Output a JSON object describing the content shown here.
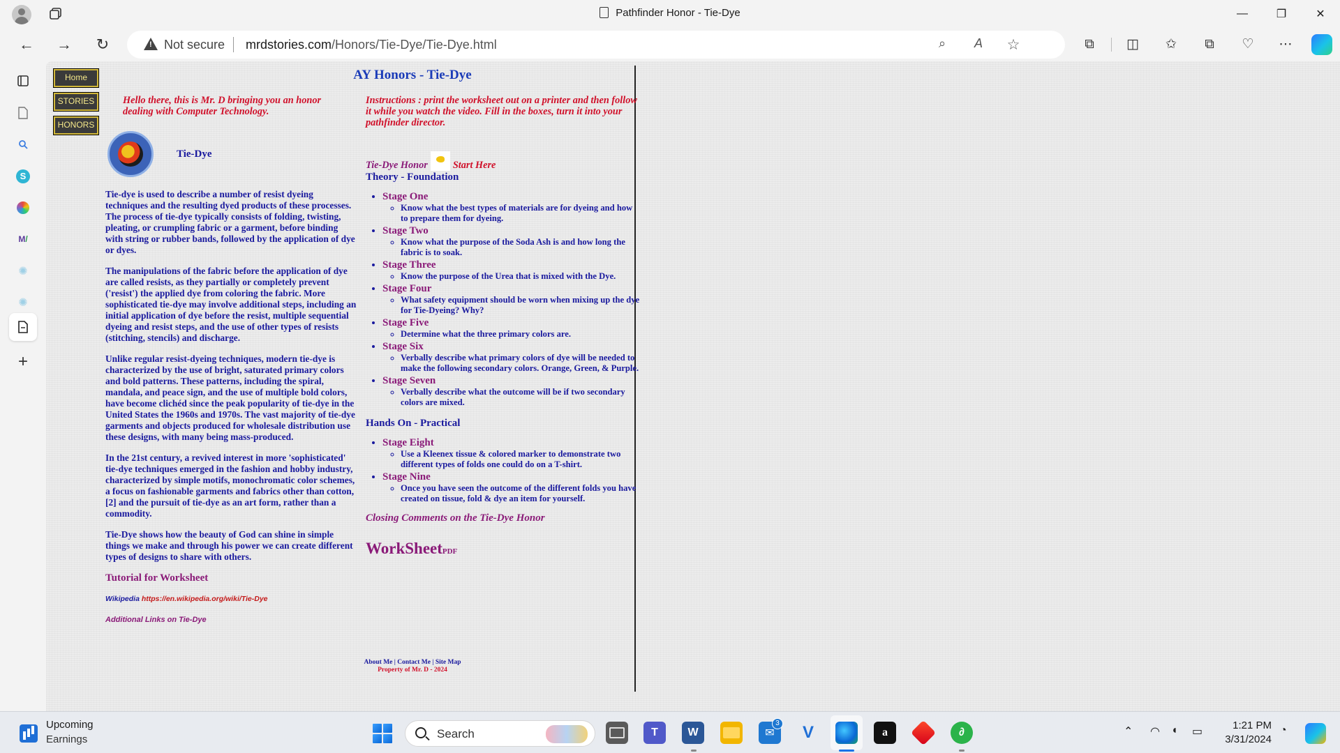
{
  "browser": {
    "tab_title": "Pathfinder Honor - Tie-Dye",
    "security_label": "Not secure",
    "url_domain": "mrdstories.com",
    "url_path": "/Honors/Tie-Dye/Tie-Dye.html",
    "window_controls": {
      "minimize": "—",
      "restore": "❐",
      "close": "✕"
    },
    "nav": {
      "back": "←",
      "forward": "→",
      "refresh": "↻"
    },
    "omni_icons": {
      "zoom": "⌕",
      "read_aloud": "A",
      "favorite": "☆"
    },
    "toolbar_icons": {
      "extensions": "⧉",
      "split": "◫",
      "favorites": "✩",
      "collections": "⧉",
      "performance": "♡",
      "more": "⋯"
    }
  },
  "sidebar_icons": [
    "tab-actions",
    "page",
    "search",
    "skype",
    "games",
    "microsoft-365",
    "ai-1",
    "ai-2",
    "active-page",
    "add"
  ],
  "site": {
    "nav": [
      "Home",
      "STORIES",
      "HONORS"
    ],
    "title": "AY Honors - Tie-Dye",
    "intro": "Hello there, this is Mr. D bringing you an honor dealing with Computer Technology.",
    "logo_label": "Tie-Dye",
    "paragraphs": [
      "Tie-dye is used to describe a number of resist dyeing techniques and the resulting dyed products of these processes. The process of tie-dye typically consists of folding, twisting, pleating, or crumpling fabric or a garment, before binding with string or rubber bands, followed by the application of dye or dyes.",
      "The manipulations of the fabric before the application of dye are called resists, as they partially or completely prevent ('resist') the applied dye from coloring the fabric. More sophisticated tie-dye may involve additional steps, including an initial application of dye before the resist, multiple sequential dyeing and resist steps, and the use of other types of resists (stitching, stencils) and discharge.",
      "Unlike regular resist-dyeing techniques, modern tie-dye is characterized by the use of bright, saturated primary colors and bold patterns. These patterns, including the spiral, mandala, and peace sign, and the use of multiple bold colors, have become clichéd since the peak popularity of tie-dye in the United States the 1960s and 1970s. The vast majority of tie-dye garments and objects produced for wholesale distribution use these designs, with many being mass-produced.",
      "In the 21st century, a revived interest in more 'sophisticated' tie-dye techniques emerged in the fashion and hobby industry, characterized by simple motifs, monochromatic color schemes, a focus on fashionable garments and fabrics other than cotton,[2] and the pursuit of tie-dye as an art form, rather than a commodity.",
      "Tie-Dye shows how the beauty of God can shine in simple things we make and through his power we can create different types of designs to share with others."
    ],
    "tutorial_link": "Tutorial for Worksheet",
    "wiki_label": "Wikipedia",
    "wiki_url": "https://en.wikipedia.org/wiki/Tie-Dye",
    "additional_links": "Additional Links on Tie-Dye",
    "instructions": "Instructions : print the worksheet out on a printer and then follow it while you watch the video. Fill in the boxes, turn it into your pathfinder director.",
    "honor_label": "Tie-Dye Honor",
    "start_here": "Start Here",
    "theory_heading": "Theory - Foundation",
    "theory_stages": [
      {
        "name": "Stage One",
        "task": "Know what the best types of materials are for dyeing and how to prepare them for dyeing."
      },
      {
        "name": "Stage Two",
        "task": "Know what the purpose of the Soda Ash is and how long the fabric is to soak."
      },
      {
        "name": "Stage Three",
        "task": "Know the purpose of the Urea that is mixed with the Dye."
      },
      {
        "name": "Stage Four",
        "task": "What safety equipment should be worn when mixing up the dye for Tie-Dyeing? Why?"
      },
      {
        "name": "Stage Five",
        "task": "Determine what the three primary colors are."
      },
      {
        "name": "Stage Six",
        "task": "Verbally describe what primary colors of dye will be needed to make the following secondary colors. Orange, Green, & Purple."
      },
      {
        "name": "Stage Seven",
        "task": "Verbally describe what the outcome will be if two secondary colors are mixed."
      }
    ],
    "hands_heading": "Hands On - Practical",
    "hands_stages": [
      {
        "name": "Stage Eight",
        "task": "Use a Kleenex tissue & colored marker to demonstrate two different types of folds one could do on a T-shirt."
      },
      {
        "name": "Stage Nine",
        "task": "Once you have seen the outcome of the different folds you have created on tissue, fold & dye an item for yourself."
      }
    ],
    "closing": "Closing Comments on the Tie-Dye Honor",
    "worksheet": "WorkSheet",
    "worksheet_pdf": "PDF",
    "footer_links": "About Me | Contact Me | Site Map",
    "footer_property": "Property of Mr. D - 2024"
  },
  "taskbar": {
    "weather_title": "Upcoming",
    "weather_sub": "Earnings",
    "search_placeholder": "Search",
    "mail_badge": "3",
    "time": "1:21 PM",
    "date": "3/31/2024"
  },
  "colors": {
    "link_blue": "#1a1a9e",
    "accent_red": "#d0102a",
    "purple": "#8a1a78",
    "title_blue": "#1a3bb8"
  }
}
